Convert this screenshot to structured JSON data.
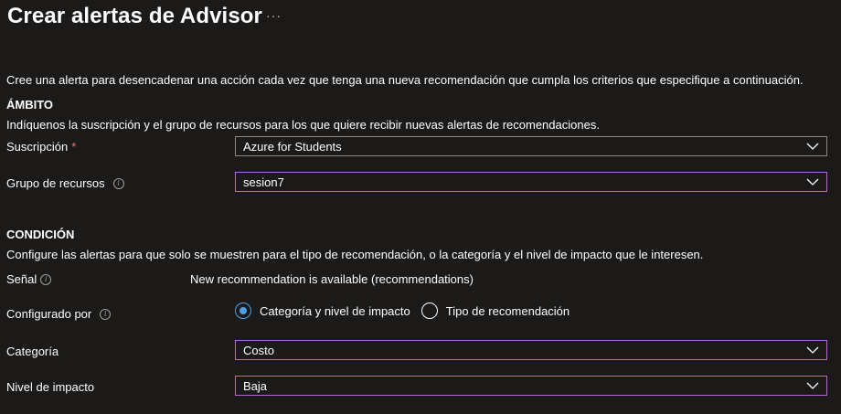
{
  "header": {
    "title": "Crear alertas de Advisor",
    "more": "···"
  },
  "intro": "Cree una alerta para desencadenar una acción cada vez que tenga una nueva recomendación que cumpla los criterios que especifique a continuación.",
  "scope": {
    "heading": "ÁMBITO",
    "description": "Indíquenos la suscripción y el grupo de recursos para los que quiere recibir nuevas alertas de recomendaciones.",
    "subscription_label": "Suscripción",
    "required_mark": "*",
    "subscription_value": "Azure for Students",
    "resource_group_label": "Grupo de recursos",
    "resource_group_value": "sesion7"
  },
  "condition": {
    "heading": "CONDICIÓN",
    "description": "Configure las alertas para que solo se muestren para el tipo de recomendación, o la categoría y el nivel de impacto que le interesen.",
    "signal_label": "Señal",
    "signal_value": "New recommendation is available (recommendations)",
    "configured_by_label": "Configurado por",
    "options": [
      "Categoría y nivel de impacto",
      "Tipo de recomendación"
    ],
    "selected_option": "Categoría y nivel de impacto",
    "category_label": "Categoría",
    "category_value": "Costo",
    "impact_label": "Nivel de impacto",
    "impact_value": "Baja"
  },
  "icons": {
    "info": "info-icon",
    "chevron": "chevron-down-icon"
  },
  "colors": {
    "background": "#1b1a19",
    "focus_border": "#b865d6",
    "radio_accent": "#4f9fe5",
    "required": "#f1707b"
  }
}
